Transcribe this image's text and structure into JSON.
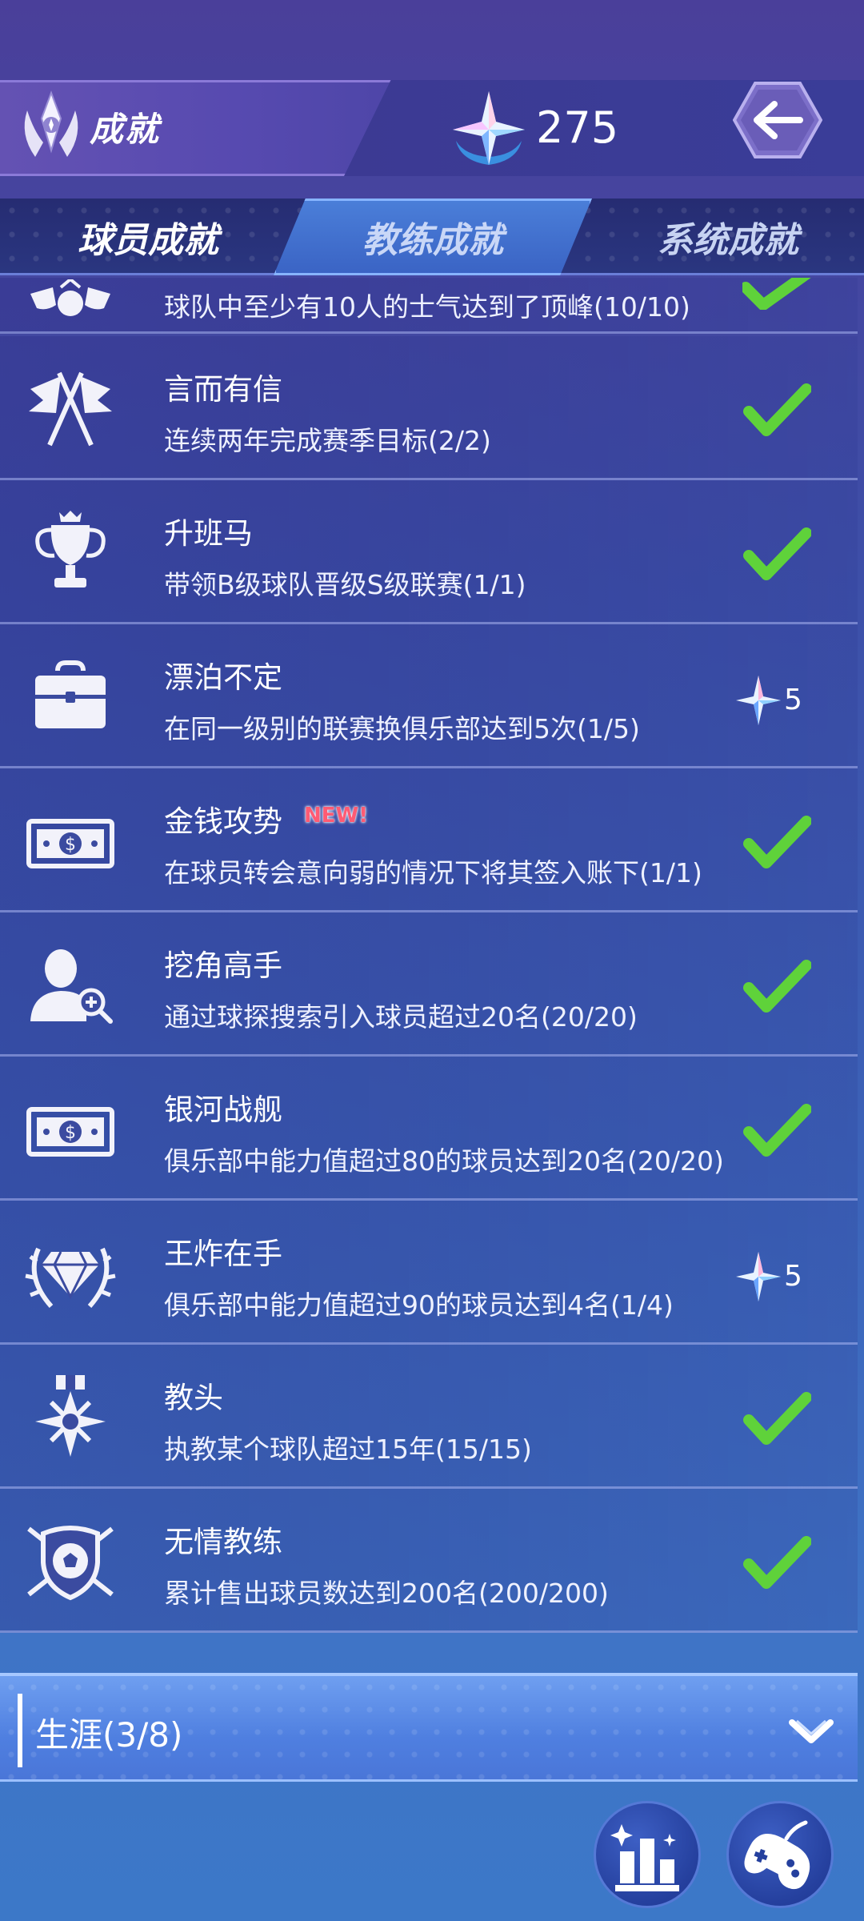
{
  "header": {
    "title": "成就",
    "gem_count": "275",
    "title_icon": "wreath-emblem-icon",
    "gem_icon": "crystal-star-icon",
    "back_icon": "back-arrow-icon"
  },
  "tabs": [
    {
      "label": "球员成就",
      "selected": false
    },
    {
      "label": "教练成就",
      "selected": true
    },
    {
      "label": "系统成就",
      "selected": false
    }
  ],
  "achievements": [
    {
      "icon": "fan-emblem-icon",
      "title": "",
      "desc": "球队中至少有10人的士气达到了顶峰(10/10)",
      "status": "complete"
    },
    {
      "icon": "crossed-flags-icon",
      "title": "言而有信",
      "desc": "连续两年完成赛季目标(2/2)",
      "status": "complete"
    },
    {
      "icon": "trophy-icon",
      "title": "升班马",
      "desc": "带领B级球队晋级S级联赛(1/1)",
      "status": "complete"
    },
    {
      "icon": "toolbox-icon",
      "title": "漂泊不定",
      "desc": "在同一级别的联赛换俱乐部达到5次(1/5)",
      "status": "reward",
      "reward": "5"
    },
    {
      "icon": "money-bill-icon",
      "title": "金钱攻势",
      "new_label": "NEW!",
      "desc": "在球员转会意向弱的情况下将其签入账下(1/1)",
      "status": "complete"
    },
    {
      "icon": "scout-search-icon",
      "title": "挖角高手",
      "desc": "通过球探搜索引入球员超过20名(20/20)",
      "status": "complete"
    },
    {
      "icon": "money-bill-icon",
      "title": "银河战舰",
      "desc": "俱乐部中能力值超过80的球员达到20名(20/20)",
      "status": "complete"
    },
    {
      "icon": "diamond-wreath-icon",
      "title": "王炸在手",
      "desc": "俱乐部中能力值超过90的球员达到4名(1/4)",
      "status": "reward",
      "reward": "5"
    },
    {
      "icon": "star-medal-icon",
      "title": "教头",
      "desc": "执教某个球队超过15年(15/15)",
      "status": "complete"
    },
    {
      "icon": "football-shield-icon",
      "title": "无情教练",
      "desc": "累计售出球员数达到200名(200/200)",
      "status": "complete"
    }
  ],
  "career": {
    "label": "生涯(3/8)",
    "icon": "chevron-down-icon"
  },
  "bottom_buttons": {
    "stats_icon": "bar-chart-icon",
    "game_icon": "gamepad-icon"
  },
  "colors": {
    "check": "#5fd23a",
    "new_badge": "#ff5b73",
    "tab_selected": "#4b7fd9"
  }
}
